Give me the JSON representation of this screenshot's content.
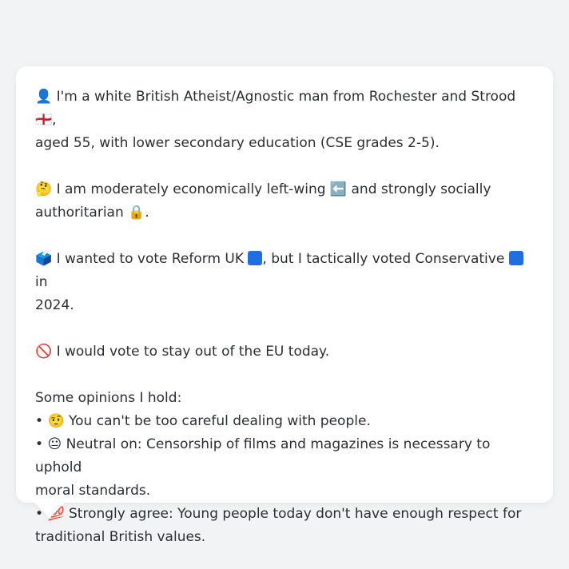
{
  "intro": {
    "icon": "👤",
    "text_before_flag": "I'm a white British Atheist/Agnostic man from Rochester and Strood",
    "flag": "🏴󠁧󠁢󠁥󠁮󠁧󠁿",
    "text_after_flag": ",",
    "line2": "aged 55, with lower secondary education (CSE grades 2-5)."
  },
  "politics": {
    "icon": "🤔",
    "text_before": "I am moderately economically left-wing",
    "arrow_icon": "⬅️",
    "text_middle": "and strongly socially",
    "line2": "authoritarian",
    "lock_icon": "🔒",
    "line2_end": "."
  },
  "vote": {
    "icon": "🗳️",
    "text_a": "I wanted to vote Reform UK",
    "text_b": ", but I tactically voted Conservative",
    "text_c": "in",
    "line2": "2024.",
    "party_color": "#1f6fe0"
  },
  "eu": {
    "icon": "🚫",
    "text": "I would vote to stay out of the EU today."
  },
  "opinions": {
    "heading": "Some opinions I hold:",
    "bullet": "•",
    "items": [
      {
        "icon": "🤨",
        "line1": "You can't be too careful dealing with people.",
        "line2": ""
      },
      {
        "icon": "😐",
        "line1": "Neutral on: Censorship of films and magazines is necessary to uphold",
        "line2": "moral standards."
      },
      {
        "icon": "💯",
        "line1": "Strongly agree: Young people today don't have enough respect for",
        "line2": "traditional British values."
      }
    ]
  }
}
